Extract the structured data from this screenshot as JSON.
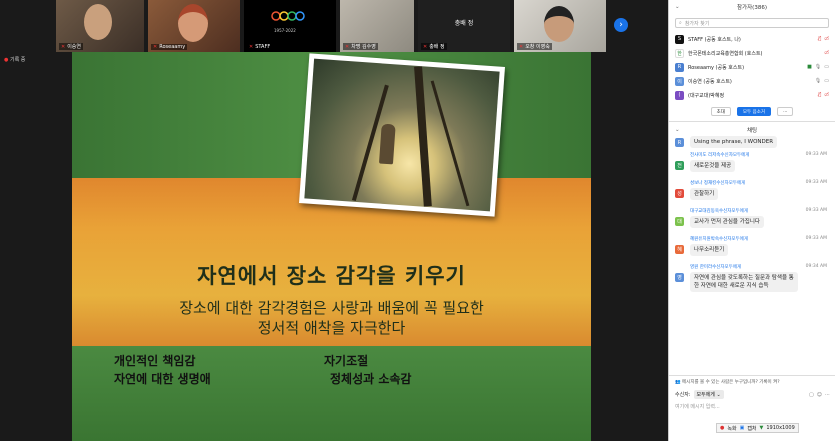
{
  "video_strip": {
    "tiles": [
      {
        "name": "이승연"
      },
      {
        "name": "Roseaamy"
      },
      {
        "name": "STAFF"
      },
      {
        "name": "차명 김수영"
      },
      {
        "name": "충배 정",
        "center_label": "충배 정"
      },
      {
        "name": "오창 이영숙"
      }
    ],
    "staff_logo_text": "1957-2022"
  },
  "recording": {
    "label": "기록 중"
  },
  "slide": {
    "title": "자연에서 장소 감각을 키우기",
    "subtitle_line1": "장소에 대한 감각경험은 사랑과 배움에 꼭 필요한",
    "subtitle_line2": "정서적 애착을 자극한다",
    "list_left": [
      "개인적인 책임감",
      "자연에 대한 생명애"
    ],
    "list_right": [
      "자기조절",
      "정체성과 소속감"
    ]
  },
  "participants_panel": {
    "title": "참가자(386)",
    "search_placeholder": "참가자 찾기",
    "items": [
      {
        "name": "STAFF (공동 호스트, 나)",
        "avatar_color": "#111111",
        "avatar_text": "S"
      },
      {
        "name": "한국몬테소리교육총연합회 (호스트)",
        "avatar_color": "#ffffff",
        "avatar_text": "한"
      },
      {
        "name": "Roseaamy (공동 호스트)",
        "avatar_color": "#4a7fd0",
        "avatar_text": "R"
      },
      {
        "name": "이승연 (공동 호스트)",
        "avatar_color": "#5b8fd9",
        "avatar_text": "이"
      },
      {
        "name": "(대구교대)박혜정",
        "avatar_color": "#7a4cc2",
        "avatar_text": "("
      }
    ],
    "invite_button": "초대",
    "mute_all_button": "모두 음소거",
    "more_button": "..."
  },
  "chat_panel": {
    "title": "채팅",
    "messages": [
      {
        "sender": "",
        "time": "",
        "text": "Using the phrase, I WONDER",
        "avatar_color": "#5b8fd9",
        "avatar_text": "R"
      },
      {
        "sender": "전사미도 리저속수신자모두에게",
        "time": "09:33 AM",
        "text": "새로운것을 제공",
        "avatar_color": "#2f9e5a",
        "avatar_text": "전"
      },
      {
        "sender": "성보나 정재킹수신자모두에게",
        "time": "09:33 AM",
        "text": "관찰하기",
        "avatar_color": "#e24b3b",
        "avatar_text": "성"
      },
      {
        "sender": "대구교대김동욱수신자모두에게",
        "time": "09:33 AM",
        "text": "교사가 먼저 관심을 가집니다",
        "avatar_color": "#7cc24d",
        "avatar_text": "대"
      },
      {
        "sender": "혜원유치원박숙수신자모두에게",
        "time": "09:33 AM",
        "text": "나무소리듣기",
        "avatar_color": "#e86a3a",
        "avatar_text": "혜"
      },
      {
        "sender": "영원 한미라수신자모두에게",
        "time": "09:34 AM",
        "text": "자연에 관심을 갖도록하는 질문과 탐색을 통한 자연에 대한 새로운 지식 습득",
        "avatar_color": "#5b8fd9",
        "avatar_text": "영"
      }
    ],
    "notice": "메시지를 볼 수 있는 사람은 누구입니까? 기록이 켜?",
    "recipient_label": "수신자:",
    "recipient_value": "모두에게",
    "input_placeholder": "여기에 메시지 입력..."
  },
  "status_bar": {
    "record_label": "녹화",
    "capture_label": "캡처",
    "resolution": "1910x1009"
  }
}
